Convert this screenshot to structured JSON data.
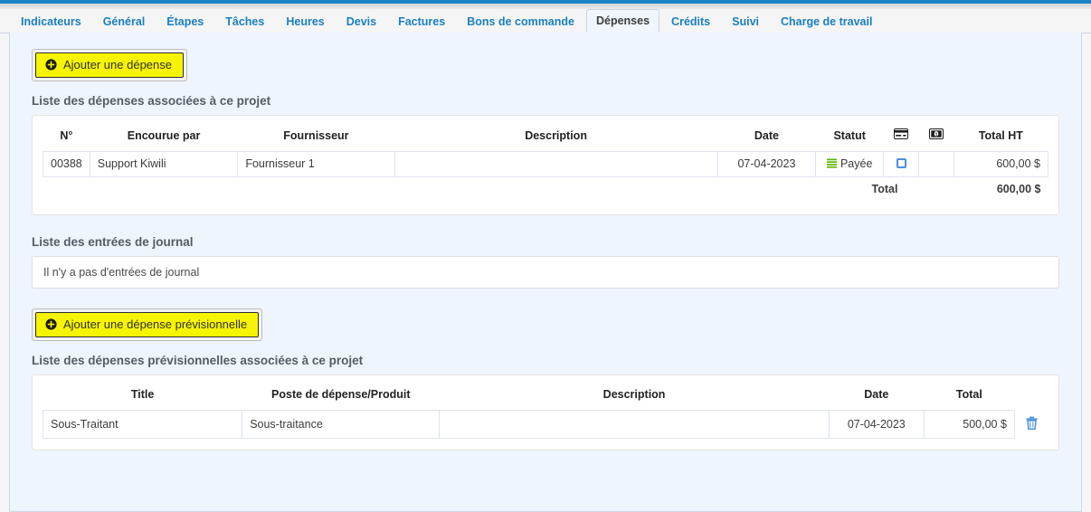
{
  "tabs": [
    {
      "label": "Indicateurs",
      "active": false
    },
    {
      "label": "Général",
      "active": false
    },
    {
      "label": "Étapes",
      "active": false
    },
    {
      "label": "Tâches",
      "active": false
    },
    {
      "label": "Heures",
      "active": false
    },
    {
      "label": "Devis",
      "active": false
    },
    {
      "label": "Factures",
      "active": false
    },
    {
      "label": "Bons de commande",
      "active": false
    },
    {
      "label": "Dépenses",
      "active": true
    },
    {
      "label": "Crédits",
      "active": false
    },
    {
      "label": "Suivi",
      "active": false
    },
    {
      "label": "Charge de travail",
      "active": false
    }
  ],
  "expenses": {
    "add_button_label": "Ajouter une dépense",
    "add_button_icon": "plus-circle-icon",
    "section_title": "Liste des dépenses associées à ce projet",
    "columns": [
      {
        "key": "no",
        "label": "N°"
      },
      {
        "key": "incurred_by",
        "label": "Encourue par"
      },
      {
        "key": "supplier",
        "label": "Fournisseur"
      },
      {
        "key": "description",
        "label": "Description"
      },
      {
        "key": "date",
        "label": "Date"
      },
      {
        "key": "status",
        "label": "Statut"
      },
      {
        "key": "card",
        "label": "",
        "icon": "credit-card-icon"
      },
      {
        "key": "cash",
        "label": "",
        "icon": "banknote-icon"
      },
      {
        "key": "total_ht",
        "label": "Total HT"
      }
    ],
    "rows": [
      {
        "no": "00388",
        "incurred_by": "Support Kiwili",
        "supplier": "Fournisseur 1",
        "description": "",
        "date": "07-04-2023",
        "status": "Payée",
        "status_icon": "green-bars-icon",
        "card_checked": false,
        "cash": "",
        "total_ht": "600,00 $"
      }
    ],
    "total_label": "Total",
    "total_value": "600,00 $"
  },
  "journal": {
    "section_title": "Liste des entrées de journal",
    "empty_message": "Il n'y a pas d'entrées de journal"
  },
  "forecast": {
    "add_button_label": "Ajouter une dépense prévisionnelle",
    "add_button_icon": "plus-circle-icon",
    "section_title": "Liste des dépenses prévisionnelles associées à ce projet",
    "columns": [
      {
        "key": "title",
        "label": "Title"
      },
      {
        "key": "expense_item",
        "label": "Poste de dépense/Produit"
      },
      {
        "key": "description",
        "label": "Description"
      },
      {
        "key": "date",
        "label": "Date"
      },
      {
        "key": "total",
        "label": "Total"
      },
      {
        "key": "actions",
        "label": ""
      }
    ],
    "rows": [
      {
        "title": "Sous-Traitant",
        "expense_item": "Sous-traitance",
        "description": "",
        "date": "07-04-2023",
        "total": "500,00 $",
        "delete_icon": "trash-icon"
      }
    ]
  },
  "colors": {
    "accent_blue": "#1a7fc1",
    "button_yellow": "#f6f400",
    "status_green": "#5cb500",
    "panel_bg": "#eef5fd",
    "topbar_blue": "#1a84c7",
    "trash_blue": "#4a90d9"
  }
}
